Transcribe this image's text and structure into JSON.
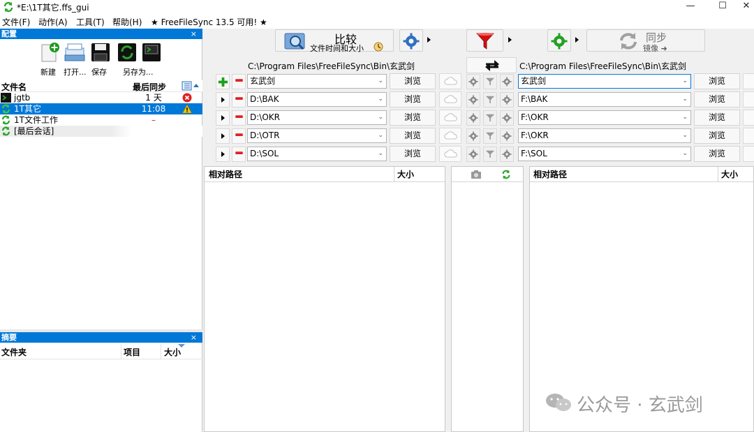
{
  "window": {
    "title": "*E:\\1T其它.ffs_gui",
    "minimize_label": "—",
    "maximize_label": "☐",
    "close_label": "✕"
  },
  "menu": {
    "items": [
      "文件(F)",
      "动作(A)",
      "工具(T)",
      "帮助(H)"
    ],
    "update_notice": "★ FreeFileSync 13.5 可用! ★"
  },
  "config_panel": {
    "caption": "配置",
    "close": "×",
    "buttons": [
      "新建",
      "打开...",
      "保存",
      "另存为..."
    ],
    "columns": {
      "name": "文件名",
      "last_sync": "最后同步"
    },
    "rows": [
      {
        "name": "jgtb",
        "last_sync": "1 天",
        "status": "error"
      },
      {
        "name": "1T其它",
        "last_sync": "11:08",
        "status": "warning",
        "selected": true
      },
      {
        "name": "1T文件工作",
        "last_sync": "–",
        "status": ""
      },
      {
        "name": "[最后会话]",
        "last_sync": "",
        "status": ""
      }
    ]
  },
  "summary_panel": {
    "caption": "摘要",
    "close": "×",
    "columns": {
      "folder": "文件夹",
      "items": "项目",
      "size": "大小"
    }
  },
  "toolbar": {
    "compare_label": "比较",
    "compare_sub": "文件时间和大小",
    "sync_label": "同步",
    "sync_sub": "镜像 ➜"
  },
  "folder_pairs": {
    "left_header_path": "C:\\Program Files\\FreeFileSync\\Bin\\玄武剑",
    "right_header_path": "C:\\Program Files\\FreeFileSync\\Bin\\玄武剑",
    "browse_label": "浏览",
    "rows": [
      {
        "left": "玄武剑",
        "right": "玄武剑"
      },
      {
        "left": "D:\\BAK",
        "right": "F:\\BAK"
      },
      {
        "left": "D:\\OKR",
        "right": "F:\\OKR"
      },
      {
        "left": "D:\\OTR",
        "right": "F:\\OKR"
      },
      {
        "left": "D:\\SOL",
        "right": "F:\\SOL"
      }
    ]
  },
  "grid": {
    "left_col_path": "相对路径",
    "left_col_size": "大小",
    "right_col_path": "相对路径",
    "right_col_size": "大小"
  },
  "watermark": "公众号 · 玄武剑",
  "colors": {
    "accent": "#0078d7",
    "sync_green": "#2aa52a",
    "filter_red": "#d01010",
    "error_red": "#e02020",
    "warning_yellow": "#f2c200"
  }
}
